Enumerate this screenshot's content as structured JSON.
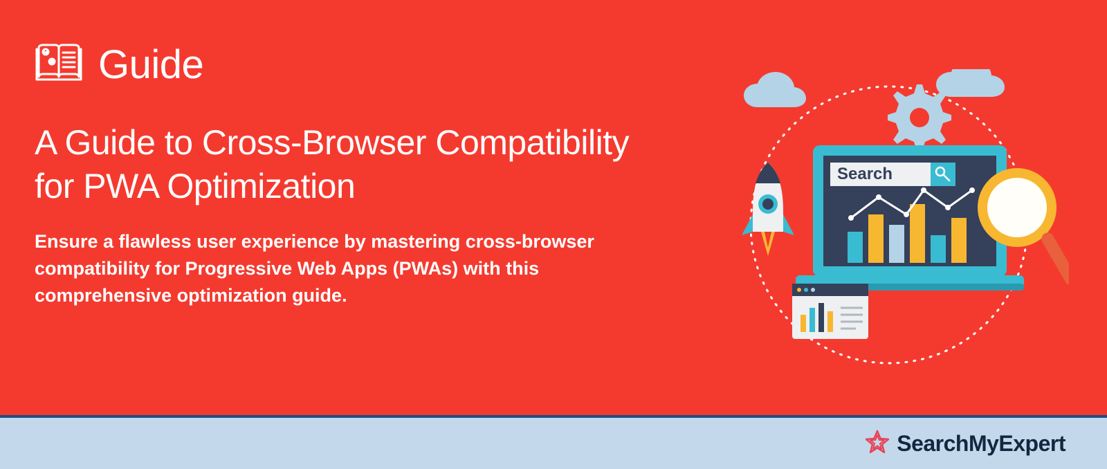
{
  "category_label": "Guide",
  "title": "A Guide to Cross-Browser Compatibility for PWA Optimization",
  "subtitle": "Ensure a flawless user experience by mastering cross-browser compatibility for Progressive Web Apps (PWAs) with this comprehensive optimization guide.",
  "brand": "SearchMyExpert",
  "illustration": {
    "search_label": "Search"
  },
  "colors": {
    "bg": "#f43a2f",
    "footer": "#c4d8eb",
    "accent": "#1f4e82",
    "star": "#e64458"
  }
}
